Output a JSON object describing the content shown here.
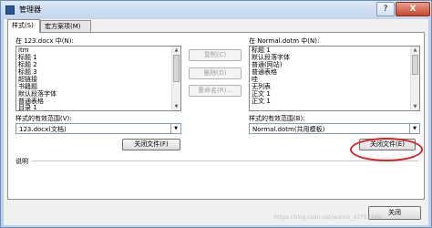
{
  "window": {
    "title": "管理器",
    "help_label": "?",
    "close_label": "X"
  },
  "tabs": [
    {
      "label": "样式(S)",
      "active": true
    },
    {
      "label": "宏方案项(M)",
      "active": false
    }
  ],
  "left_pane": {
    "label": "在 123.docx 中(N):",
    "items": [
      "itm",
      "标题 1",
      "标题 2",
      "标题 3",
      "超链接",
      "书籍题",
      "默认段落字体",
      "普通表格",
      "目录 1"
    ],
    "scope_label": "样式的有效范围(V):",
    "scope_value": "123.docx(文档)",
    "close_file_label": "关闭文件(F)"
  },
  "middle_buttons": {
    "copy_label": "复制(C)",
    "delete_label": "删除(D)",
    "rename_label": "重命名(R)..."
  },
  "right_pane": {
    "label": "在 Normal.dotm 中(N):",
    "items": [
      "标题 1",
      "默认段落字体",
      "普通(网站)",
      "普通表格",
      "哇",
      "无列表",
      "正文 1",
      "正文 1"
    ],
    "scope_label": "样式的有效范围(B):",
    "scope_value": "Normal.dotm(共用模板)",
    "close_file_label": "关闭文件(E)"
  },
  "description_label": "说明",
  "close_button_label": "关闭",
  "watermark": "https://blog.csdn.net/weixin_43793166",
  "colors": {
    "highlight_ellipse": "#e02020",
    "titlebar": "#c2d6ec"
  }
}
